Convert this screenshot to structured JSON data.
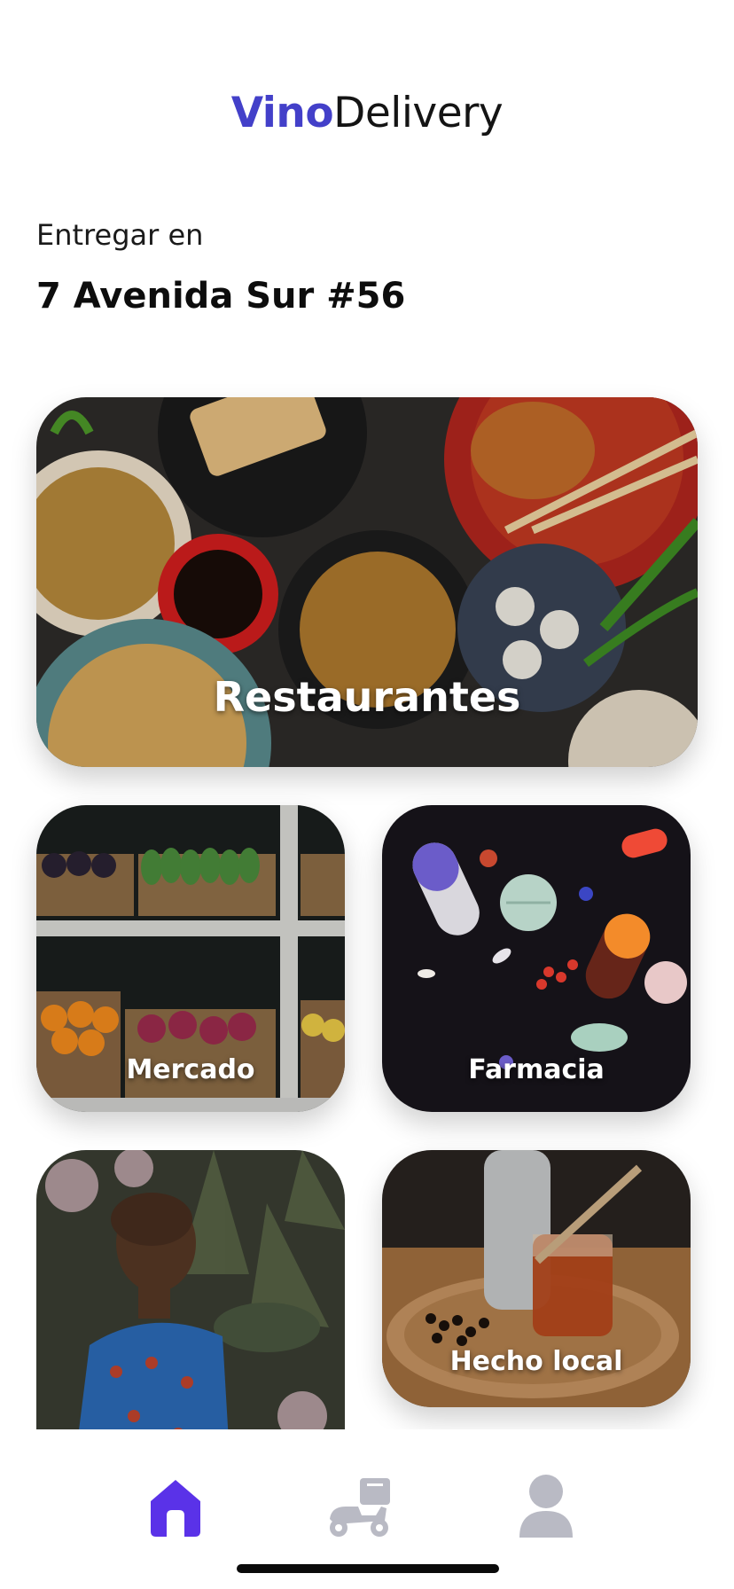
{
  "header": {
    "brand_bold": "Vino",
    "brand_light": "Delivery"
  },
  "delivery": {
    "label": "Entregar en",
    "address": "7 Avenida Sur #56"
  },
  "categories": [
    {
      "label": "Restaurantes"
    },
    {
      "label": "Mercado"
    },
    {
      "label": "Farmacia"
    },
    {
      "label": ""
    },
    {
      "label": "Hecho local"
    }
  ],
  "tabs": [
    {
      "icon": "home-icon",
      "active": true,
      "color": "#5a32e8"
    },
    {
      "icon": "delivery-scooter-icon",
      "active": false,
      "color": "#b9bac4"
    },
    {
      "icon": "user-icon",
      "active": false,
      "color": "#b9bac4"
    }
  ],
  "colors": {
    "brand": "#4340c9",
    "active_tab": "#5a32e8",
    "inactive_tab": "#b9bac4"
  }
}
